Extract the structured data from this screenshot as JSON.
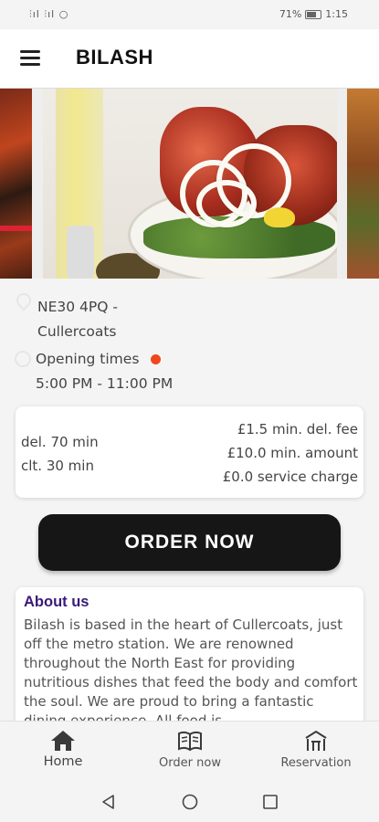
{
  "status_bar": {
    "left": "⫶ıl ⫶ıl ○",
    "battery_percent": "71%",
    "time": "1:15"
  },
  "app_bar": {
    "title": "BILASH"
  },
  "location": {
    "address_line1": "NE30 4PQ -",
    "address_line2": "Cullercoats"
  },
  "opening": {
    "label": "Opening times",
    "hours": "5:00 PM - 11:00 PM",
    "status_color": "#f0471a"
  },
  "delivery_info": {
    "delivery_time": "del. 70 min",
    "collection_time": "clt. 30 min",
    "min_delivery_fee": "£1.5 min. del. fee",
    "min_amount": "£10.0 min. amount",
    "service_charge": "£0.0 service charge"
  },
  "order_button": {
    "label": "ORDER NOW"
  },
  "about": {
    "title": "About us",
    "text": "Bilash is based in the heart of Cullercoats, just off the metro station. We are renowned throughout the North East for providing nutritious dishes that feed the body and comfort the soul. We are proud to bring a fantastic dining experience. All food is"
  },
  "bottom_nav": {
    "items": [
      {
        "label": "Home",
        "icon": "home-icon"
      },
      {
        "label": "Order now",
        "icon": "menu-book-icon"
      },
      {
        "label": "Reservation",
        "icon": "restaurant-icon"
      }
    ]
  },
  "colors": {
    "accent_dark": "#161616",
    "about_title": "#3a1a78"
  }
}
